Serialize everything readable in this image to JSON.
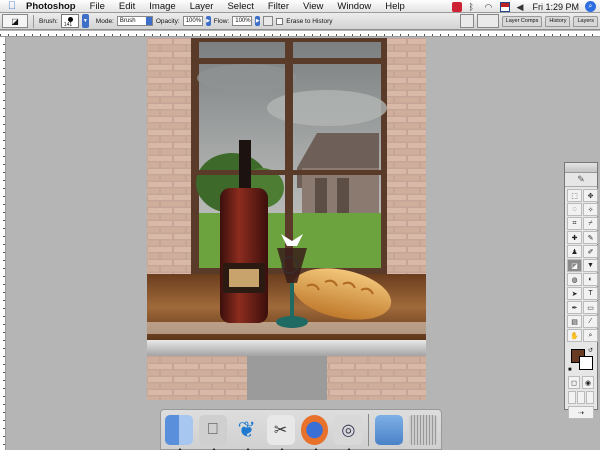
{
  "menubar": {
    "apple_icon": "apple-icon",
    "items": [
      "Photoshop",
      "File",
      "Edit",
      "Image",
      "Layer",
      "Select",
      "Filter",
      "View",
      "Window",
      "Help"
    ],
    "clock": "Fri 1:29 PM",
    "status_icons": [
      "photoshop-status-icon",
      "bluetooth-icon",
      "wifi-icon",
      "flag-icon",
      "volume-icon"
    ]
  },
  "options": {
    "brush_label": "Brush:",
    "brush_size": "141",
    "mode_label": "Mode:",
    "mode_value": "Brush",
    "opacity_label": "Opacity:",
    "opacity_value": "100%",
    "flow_label": "Flow:",
    "flow_value": "100%",
    "erase_history_label": "Erase to History"
  },
  "palette_well": {
    "tabs": [
      "Layer Comps",
      "History",
      "Layers"
    ]
  },
  "tools": {
    "items": [
      "marquee-tool",
      "move-tool",
      "lasso-tool",
      "magic-wand-tool",
      "crop-tool",
      "slice-tool",
      "healing-tool",
      "brush-tool",
      "stamp-tool",
      "history-brush-tool",
      "eraser-tool",
      "fill-tool",
      "blur-tool",
      "dodge-tool",
      "path-select-tool",
      "type-tool",
      "pen-tool",
      "shape-tool",
      "notes-tool",
      "eyedropper-tool",
      "hand-tool",
      "zoom-tool"
    ],
    "glyphs": [
      "⬚",
      "✥",
      "◌",
      "✧",
      "⌗",
      "⌿",
      "✚",
      "✎",
      "♟",
      "✐",
      "◪",
      "▼",
      "◍",
      "◐",
      "➤",
      "T",
      "✒",
      "▭",
      "▤",
      "⁄",
      "✋",
      "⌕"
    ],
    "selected_index": 10,
    "foreground_color": "#6a3b23",
    "background_color": "#ffffff"
  },
  "dock": {
    "icons": [
      "finder-icon",
      "system-prefs-icon",
      "feather-app-icon",
      "scissors-app-icon",
      "firefox-icon",
      "network-app-icon",
      "documents-folder-icon",
      "trash-icon"
    ]
  }
}
